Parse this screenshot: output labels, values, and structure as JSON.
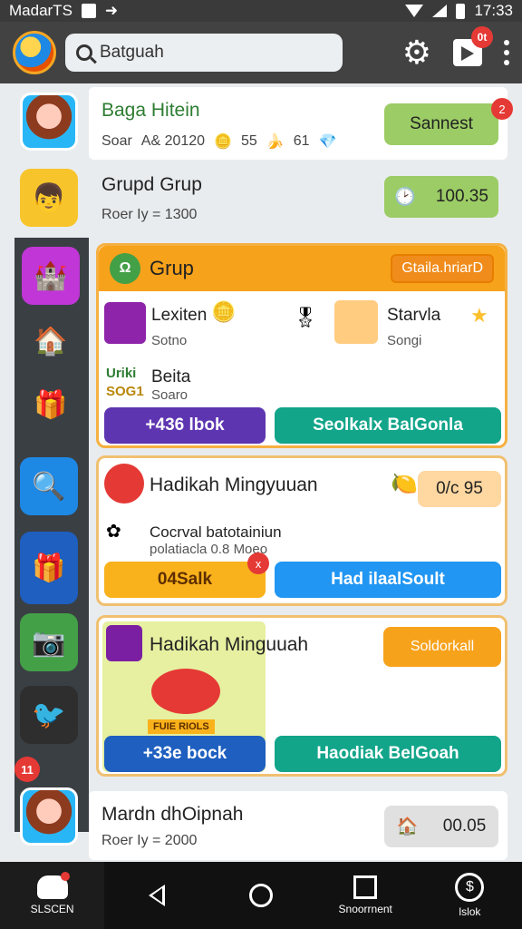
{
  "status_bar": {
    "carrier": "MadarTS",
    "time": "17:33"
  },
  "app_bar": {
    "search_text": "Batguah",
    "notification_count": "0t"
  },
  "rail": {
    "badge": "11"
  },
  "rows": [
    {
      "title": "Baga Hitein",
      "meta": [
        "Soar",
        "A& 20120",
        "55",
        "61"
      ],
      "action": "Sannest",
      "action_badge": "2"
    },
    {
      "title": "Grupd Grup",
      "sub": "Roer Iy = 1300",
      "value": "100.35"
    }
  ],
  "card_group": {
    "header": "Grup",
    "header_button": "Gtaila.hriarD",
    "items": [
      {
        "name": "Lexiten",
        "sub": "Sotno"
      },
      {
        "name": "Starvla",
        "sub": "Songi"
      },
      {
        "name": "Beita",
        "sub": "Soaro",
        "tag1": "Uriki",
        "tag2": "SOG1"
      }
    ],
    "btn_left": "+436 lbok",
    "btn_right": "Seolkalx BalGonla"
  },
  "card_hadikah1": {
    "title": "Hadikah Mingyuuan",
    "value": "0/c 95",
    "line1": "Cocrval batotainiun",
    "line2": "polatiacla 0.8 Moeo",
    "btn_left": "04Salk",
    "btn_left_badge": "x",
    "btn_right": "Had ilaalSoult"
  },
  "card_hadikah2": {
    "title": "Hadikah Minguuah",
    "header_btn": "Soldorkall",
    "btn_left": "+33e bock",
    "btn_right": "Haodiak BelGoah",
    "plaque": "FUIE RIOLS"
  },
  "bottom_row": {
    "title": "Mardn dhOipnah",
    "sub": "Roer Iy = 2000",
    "value": "00.05"
  },
  "nav": {
    "item1": "SLSCEN",
    "item4": "Snoorrnent",
    "item5": "lslok"
  },
  "colors": {
    "accent_orange": "#f7a21b",
    "green": "#8bc34a",
    "teal": "#12a58a",
    "blue": "#2196f3",
    "purple": "#5e35b1"
  }
}
